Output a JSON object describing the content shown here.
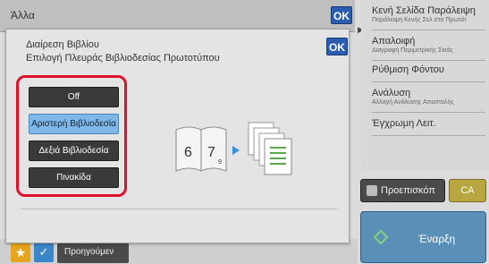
{
  "window": {
    "title": "Άλλα",
    "ok_label": "OK"
  },
  "right_panel": {
    "items": [
      {
        "label": "Κενή Σελίδα Παράλειψη",
        "sub": "Παράλειψη Κενής Σελ στο Πρωτότ"
      },
      {
        "label": "Απαλοιφή",
        "sub": "Διαγραφή Περιμετρικής Σκιάς"
      },
      {
        "label": "Ρύθμιση Φόντου",
        "sub": ""
      },
      {
        "label": "Ανάλυση",
        "sub": "Αλλαγή Ανάλυσης Αποστολής"
      },
      {
        "label": "Έγχρωμη Λειτ.",
        "sub": ""
      }
    ]
  },
  "buttons": {
    "preview": "Προεπισκόπ",
    "ca": "CA",
    "start": "Έναρξη",
    "previous": "Προηγούμεν"
  },
  "dialog": {
    "title_line1": "Διαίρεση Βιβλίου",
    "title_line2": "Επιλογή Πλευράς Βιβλιοδεσίας Πρωτοτύπου",
    "ok_label": "OK",
    "options": [
      {
        "label": "Off",
        "selected": false
      },
      {
        "label": "Αριστερή Βιβλιοδεσία",
        "selected": true
      },
      {
        "label": "Δεξιά Βιβλιοδεσία",
        "selected": false
      },
      {
        "label": "Πινακίδα",
        "selected": false
      }
    ],
    "illustration": {
      "page_left": "6",
      "page_right": "7",
      "page_sub": "9"
    }
  },
  "colors": {
    "accent": "#2a5db0",
    "highlight_border": "#e0102a",
    "selected_option": "#7fb7e8",
    "start": "#5a8fb8",
    "ca": "#b8a640"
  }
}
